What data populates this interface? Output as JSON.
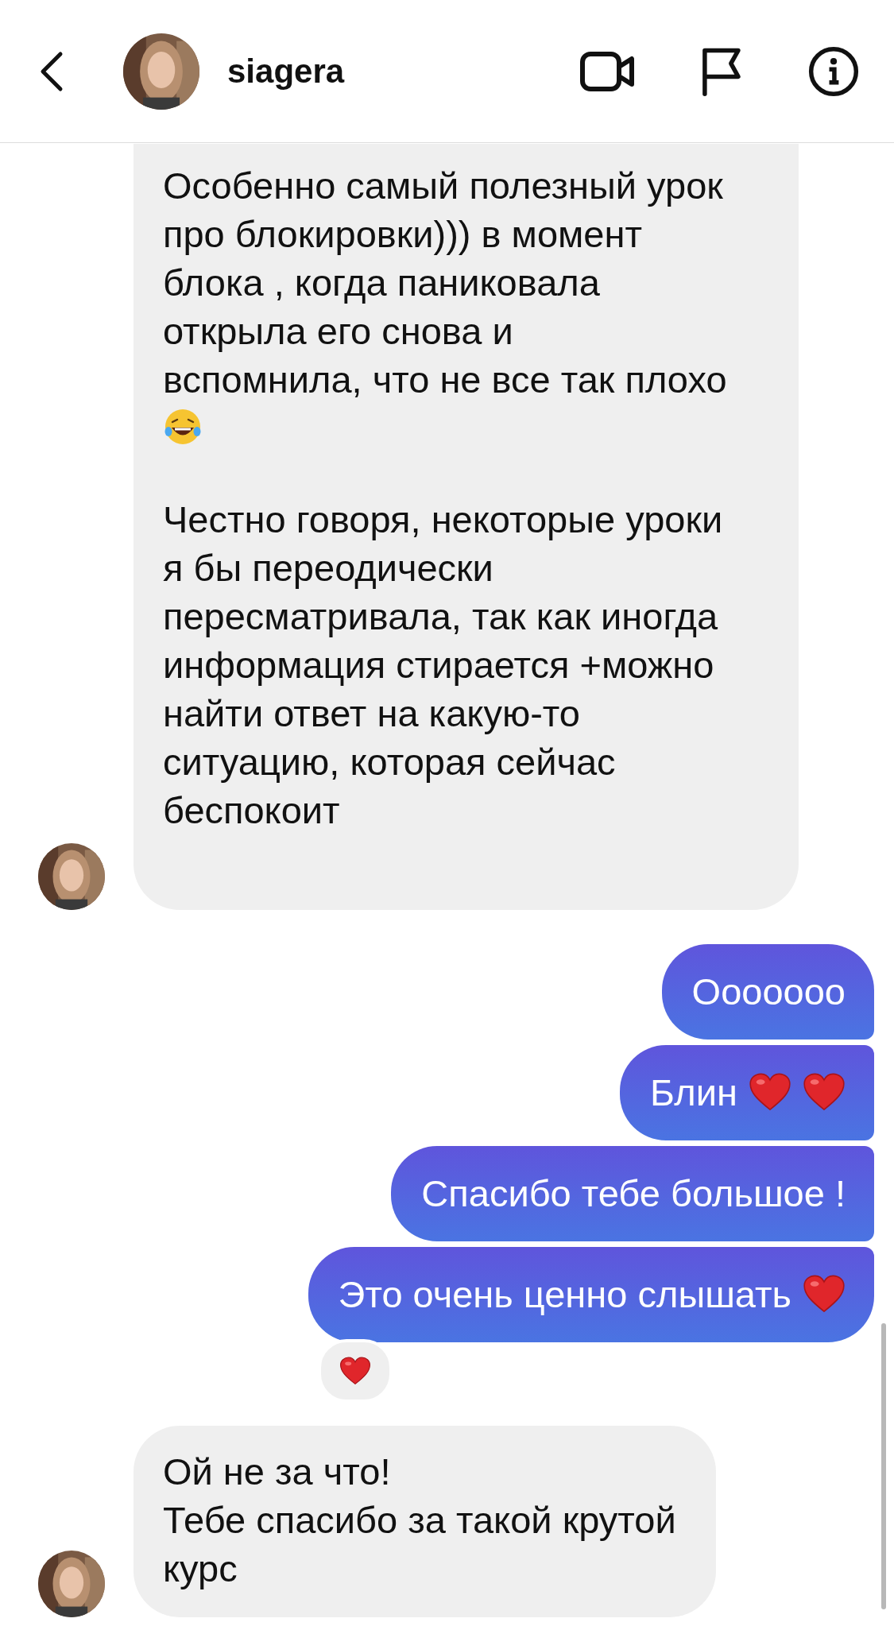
{
  "header": {
    "username": "siagera"
  },
  "messages": [
    {
      "kind": "incoming",
      "paragraphs": [
        {
          "text": "Особенно самый полезный урок\nпро блокировки))) в момент\nблока , когда паниковала\nоткрыла его снова и\nвспомнила, что не все так плохо",
          "icons": [
            {
              "kind": "laughing"
            }
          ]
        },
        {
          "text": "Честно говоря, некоторые уроки\nя бы переодически\nпересматривала, так как иногда\nинформация стирается +можно\nнайти ответ на какую-то\nситуацию, которая сейчас\nбеспокоит"
        }
      ]
    },
    {
      "kind": "outgoing",
      "paragraphs": [
        {
          "text": "Ооооооо"
        }
      ]
    },
    {
      "kind": "outgoing",
      "paragraphs": [
        {
          "text": "Блин",
          "icons": [
            {
              "kind": "heart"
            },
            {
              "kind": "heart"
            }
          ]
        }
      ]
    },
    {
      "kind": "outgoing",
      "paragraphs": [
        {
          "text": "Спасибо тебе большое !"
        }
      ]
    },
    {
      "kind": "outgoing",
      "paragraphs": [
        {
          "text": "Это очень ценно слышать",
          "icons": [
            {
              "kind": "heart"
            }
          ]
        }
      ],
      "reaction": {
        "kind": "heart"
      }
    },
    {
      "kind": "incoming",
      "paragraphs": [
        {
          "text": "Ой не за что!\nТебе спасибо за такой крутой\nкурс"
        }
      ]
    }
  ]
}
